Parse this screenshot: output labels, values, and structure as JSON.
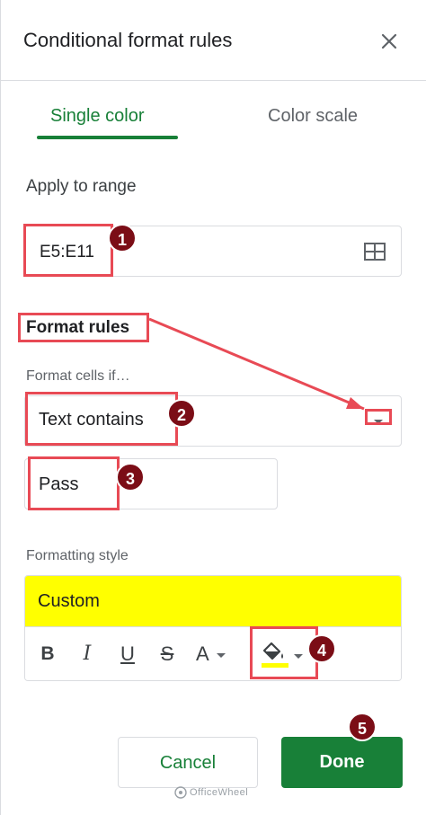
{
  "header": {
    "title": "Conditional format rules",
    "close_icon": "close-icon"
  },
  "tabs": [
    {
      "label": "Single color",
      "active": true
    },
    {
      "label": "Color scale",
      "active": false
    }
  ],
  "apply_range": {
    "label": "Apply to range",
    "value": "E5:E11",
    "icon": "grid-select-icon"
  },
  "format_rules": {
    "label": "Format rules",
    "condition_label": "Format cells if…",
    "condition_value": "Text contains",
    "value": "Pass"
  },
  "formatting_style": {
    "label": "Formatting style",
    "preview_text": "Custom",
    "preview_color": "#ffff00",
    "toolbar": {
      "bold": "B",
      "italic": "I",
      "underline": "U",
      "strikethrough": "S",
      "text_color": "A",
      "fill_color_icon": "paint-bucket-icon",
      "fill_color": "#ffff00"
    }
  },
  "actions": {
    "cancel_label": "Cancel",
    "done_label": "Done"
  },
  "watermark": "OfficeWheel",
  "annotations": {
    "badges": [
      "1",
      "2",
      "3",
      "4",
      "5"
    ],
    "color": "#e84a55",
    "badge_color": "#7b0d16"
  },
  "colors": {
    "accent": "#188038",
    "text": "#202124",
    "muted": "#5f6368",
    "border": "#dadce0"
  }
}
